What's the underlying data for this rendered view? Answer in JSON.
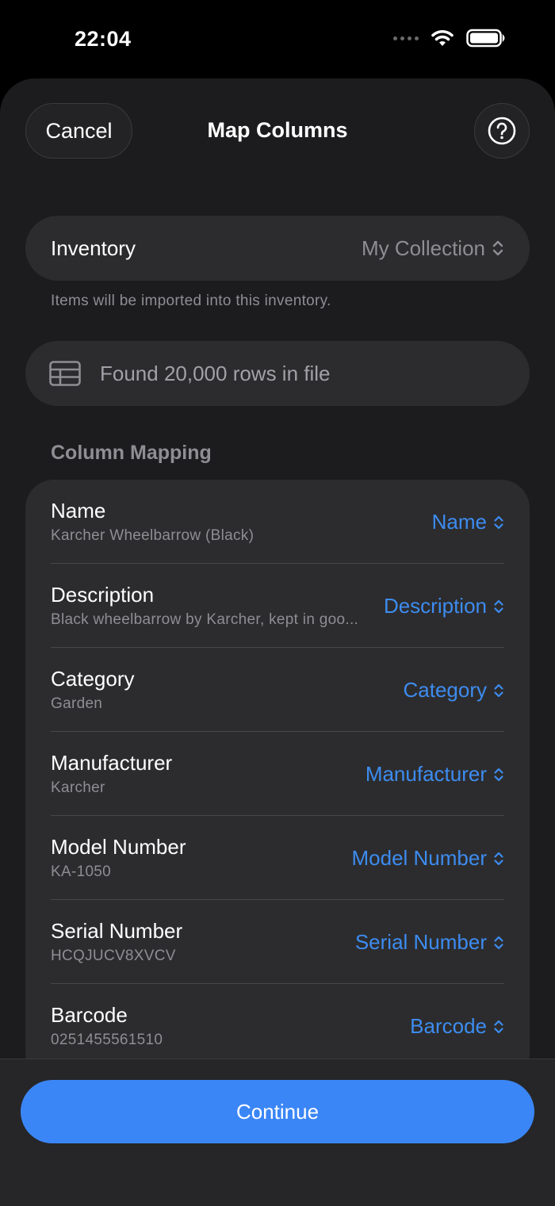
{
  "status_bar": {
    "time": "22:04",
    "icons": [
      "signal-dots-icon",
      "wifi-icon",
      "battery-icon"
    ]
  },
  "nav": {
    "cancel_label": "Cancel",
    "title": "Map Columns",
    "help_icon": "question-circle-icon"
  },
  "inventory": {
    "label": "Inventory",
    "value": "My Collection",
    "footer": "Items will be imported into this inventory."
  },
  "file_info": {
    "icon": "table-icon",
    "text": "Found 20,000 rows in file"
  },
  "column_mapping": {
    "header": "Column Mapping",
    "rows": [
      {
        "field": "Name",
        "sample": "Karcher Wheelbarrow (Black)",
        "mapped_to": "Name"
      },
      {
        "field": "Description",
        "sample": "Black wheelbarrow by Karcher, kept in goo...",
        "mapped_to": "Description"
      },
      {
        "field": "Category",
        "sample": "Garden",
        "mapped_to": "Category"
      },
      {
        "field": "Manufacturer",
        "sample": "Karcher",
        "mapped_to": "Manufacturer"
      },
      {
        "field": "Model Number",
        "sample": "KA-1050",
        "mapped_to": "Model Number"
      },
      {
        "field": "Serial Number",
        "sample": "HCQJUCV8XVCV",
        "mapped_to": "Serial Number"
      },
      {
        "field": "Barcode",
        "sample": "0251455561510",
        "mapped_to": "Barcode"
      }
    ]
  },
  "footer": {
    "continue_label": "Continue"
  },
  "colors": {
    "accent": "#3B86F7",
    "background": "#1C1C1E",
    "card": "#2C2C2E"
  }
}
